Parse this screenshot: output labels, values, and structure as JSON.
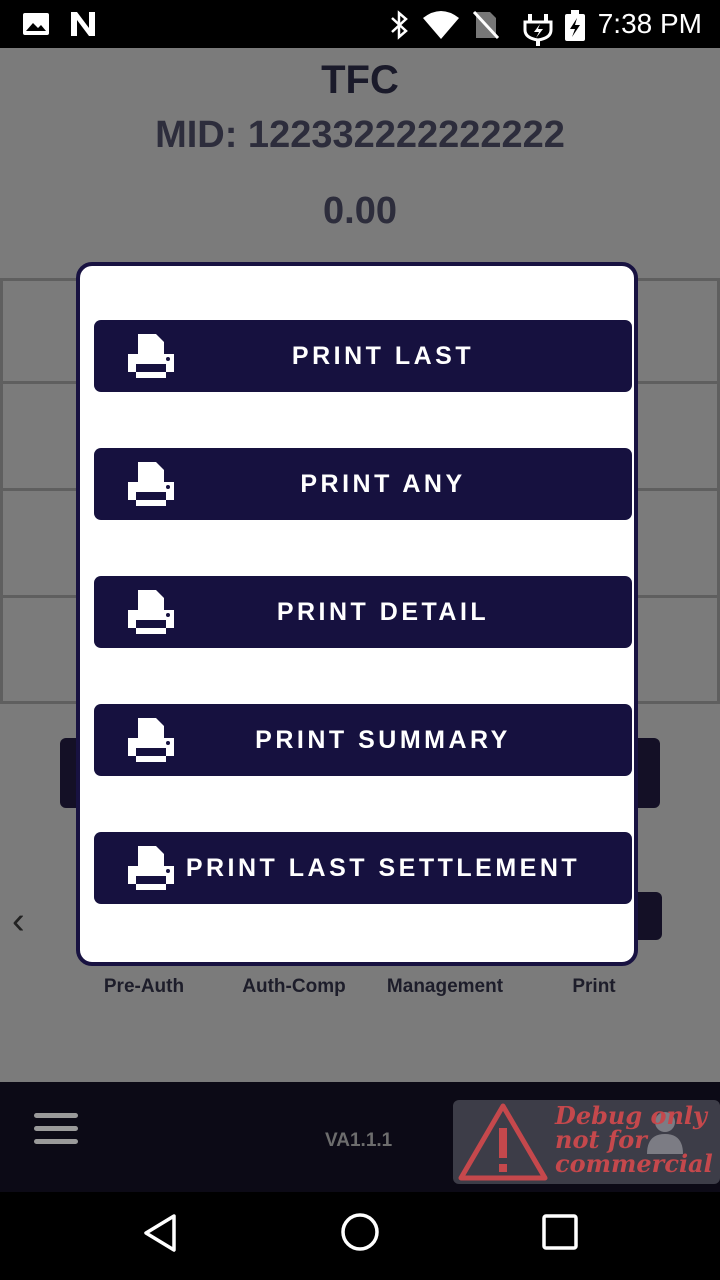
{
  "status_bar": {
    "time": "7:38 PM",
    "icons": [
      "image-icon",
      "n-logo-icon",
      "bluetooth-icon",
      "wifi-icon",
      "no-sim-icon",
      "usb-charging-icon",
      "battery-charging-icon"
    ]
  },
  "header": {
    "title": "TFC",
    "mid": "MID: 122332222222222",
    "amount": "0.00"
  },
  "functions": [
    "Pre-Auth",
    "Auth-Comp",
    "Management",
    "Print"
  ],
  "footer": {
    "version": "VA1.1.1",
    "debug_watermark": {
      "line1": "Debug only",
      "line2": "not for",
      "line3": "commercial"
    }
  },
  "print_dialog": {
    "items": [
      {
        "label": "PRINT LAST",
        "icon": "printer-icon"
      },
      {
        "label": "PRINT ANY",
        "icon": "printer-icon"
      },
      {
        "label": "PRINT DETAIL",
        "icon": "printer-icon"
      },
      {
        "label": "PRINT SUMMARY",
        "icon": "printer-icon"
      },
      {
        "label": "PRINT LAST SETTLEMENT",
        "icon": "printer-icon"
      }
    ]
  },
  "colors": {
    "accent": "#16113f",
    "overlay": "#7b7b7b",
    "dialog_bg": "#ffffff",
    "bottom_bar": "#0c0a16",
    "debug_text": "#c5484c"
  }
}
